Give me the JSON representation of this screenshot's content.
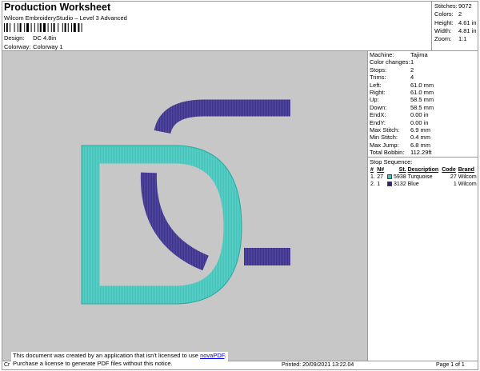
{
  "header": {
    "title": "Production Worksheet",
    "subtitle": "Wilcom EmbroideryStudio – Level 3 Advanced",
    "design_label": "Design:",
    "design_value": "DC 4.8in",
    "colorway_label": "Colorway:",
    "colorway_value": "Colorway 1"
  },
  "summary": [
    {
      "label": "Stitches:",
      "value": "9072"
    },
    {
      "label": "Colors:",
      "value": "2"
    },
    {
      "label": "Height:",
      "value": "4.61 in"
    },
    {
      "label": "Width:",
      "value": "4.81 in"
    },
    {
      "label": "Zoom:",
      "value": "1:1"
    }
  ],
  "info": [
    {
      "label": "Machine:",
      "value": "Tajima"
    },
    {
      "label": "Color changes:",
      "value": "1"
    },
    {
      "label": "Stops:",
      "value": "2"
    },
    {
      "label": "Trims:",
      "value": "4"
    },
    {
      "label": "Left:",
      "value": "61.0 mm"
    },
    {
      "label": "Right:",
      "value": "61.0 mm"
    },
    {
      "label": "Up:",
      "value": "58.5 mm"
    },
    {
      "label": "Down:",
      "value": "58.5 mm"
    },
    {
      "label": "EndX:",
      "value": "0.00 in"
    },
    {
      "label": "EndY:",
      "value": "0.00 in"
    },
    {
      "label": "Max Stitch:",
      "value": "6.9 mm"
    },
    {
      "label": "Min Stitch:",
      "value": "0.4 mm"
    },
    {
      "label": "Max Jump:",
      "value": "6.8 mm"
    },
    {
      "label": "Total Bobbin:",
      "value": "112.29ft"
    }
  ],
  "stop_sequence": {
    "heading": "Stop Sequence:",
    "columns": [
      "#",
      "N#",
      "St.",
      "Description",
      "Code",
      "Brand"
    ],
    "rows": [
      {
        "num": "1.",
        "n": "27",
        "color": "#3ec8be",
        "st": "5938",
        "desc": "Turquoise",
        "code": "27",
        "brand": "Wilcom"
      },
      {
        "num": "2.",
        "n": "1",
        "color": "#2a237a",
        "st": "3132",
        "desc": "Blue",
        "code": "1",
        "brand": "Wilcom"
      }
    ]
  },
  "colors": {
    "turquoise": "#3ec8be",
    "blue": "#3d3294",
    "canvas": "#c7c7c7"
  },
  "notice": {
    "line1_prefix": "This document was created by an application that isn't licensed to use ",
    "link": "novaPDF",
    "line1_suffix": ".",
    "line2": "Purchase a license to generate PDF files without this notice."
  },
  "footer": {
    "left": "Cr",
    "printed": "Printed: 20/09/2021 13:22.04",
    "page": "Page 1 of 1"
  }
}
